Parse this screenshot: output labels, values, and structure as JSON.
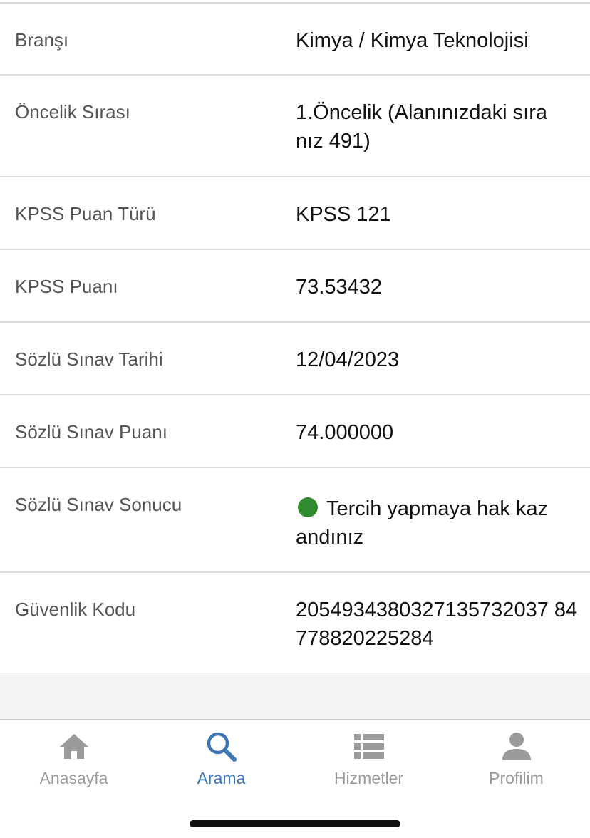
{
  "details": [
    {
      "label": "Branşı",
      "value": "Kimya / Kimya Teknolojisi"
    },
    {
      "label": "Öncelik Sırası",
      "value": "1.Öncelik (Alanınızdaki sıranız 491)"
    },
    {
      "label": "KPSS Puan Türü",
      "value": "KPSS 121"
    },
    {
      "label": "KPSS Puanı",
      "value": "73.53432"
    },
    {
      "label": "Sözlü Sınav Tarihi",
      "value": "12/04/2023"
    },
    {
      "label": "Sözlü Sınav Puanı",
      "value": "74.000000"
    },
    {
      "label": "Sözlü Sınav Sonucu",
      "value": "Tercih yapmaya hak kazandınız",
      "status_color": "#2e8b2e"
    },
    {
      "label": "Güvenlik Kodu",
      "value": "2054934380327135732037 84778820225284"
    }
  ],
  "tabbar": {
    "tabs": [
      {
        "label": "Anasayfa",
        "icon": "home-icon"
      },
      {
        "label": "Arama",
        "icon": "search-icon",
        "active": true
      },
      {
        "label": "Hizmetler",
        "icon": "list-icon"
      },
      {
        "label": "Profilim",
        "icon": "user-icon"
      }
    ],
    "active_color": "#3d76b5",
    "inactive_color": "#9b9b9b"
  }
}
